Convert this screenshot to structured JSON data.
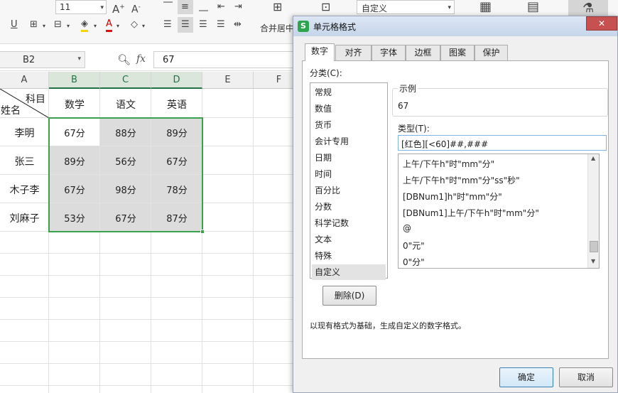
{
  "toolbar": {
    "font_size": "11",
    "number_format": "自定义",
    "merge_label": "合并居中",
    "icons": [
      "increase-font-icon",
      "decrease-font-icon",
      "align-top-icon",
      "align-middle-icon",
      "align-bottom-icon",
      "indent-icon",
      "outdent-icon",
      "underline-icon",
      "border-icon",
      "fill-color-icon",
      "font-color-icon",
      "clear-icon",
      "align-left-icon",
      "align-center-icon",
      "align-right-icon",
      "justify-icon",
      "distribute-icon"
    ]
  },
  "formula_bar": {
    "name_box": "B2",
    "fx_label": "fx",
    "value": "67"
  },
  "sheet": {
    "columns": [
      "A",
      "B",
      "C",
      "D",
      "E",
      "F"
    ],
    "header_row": {
      "corner_top": "科目",
      "corner_bottom": "姓名",
      "subjects": [
        "数学",
        "语文",
        "英语"
      ]
    },
    "rows": [
      {
        "name": "李明",
        "scores": [
          "67分",
          "88分",
          "89分"
        ]
      },
      {
        "name": "张三",
        "scores": [
          "89分",
          "56分",
          "67分"
        ]
      },
      {
        "name": "木子李",
        "scores": [
          "67分",
          "98分",
          "78分"
        ]
      },
      {
        "name": "刘麻子",
        "scores": [
          "53分",
          "67分",
          "87分"
        ]
      }
    ],
    "colors": {
      "selection_border": "#3aa24b",
      "selection_fill": "#dcdcdc",
      "header_highlight": "#217346"
    }
  },
  "dialog": {
    "title": "单元格格式",
    "close_glyph": "✕",
    "tabs": [
      "数字",
      "对齐",
      "字体",
      "边框",
      "图案",
      "保护"
    ],
    "active_tab": "数字",
    "category_label": "分类(C):",
    "categories": [
      "常规",
      "数值",
      "货币",
      "会计专用",
      "日期",
      "时间",
      "百分比",
      "分数",
      "科学记数",
      "文本",
      "特殊",
      "自定义"
    ],
    "selected_category": "自定义",
    "sample_label": "示例",
    "sample_value": "67",
    "type_label": "类型(T):",
    "type_value": "[红色][<60]##,###",
    "type_list": [
      "上午/下午h\"时\"mm\"分\"",
      "上午/下午h\"时\"mm\"分\"ss\"秒\"",
      "[DBNum1]h\"时\"mm\"分\"",
      "[DBNum1]上午/下午h\"时\"mm\"分\"",
      "@",
      "0\"元\"",
      "0\"分\""
    ],
    "delete_button": "删除(D)",
    "description": "以现有格式为基础，生成自定义的数字格式。",
    "ok_button": "确定",
    "cancel_button": "取消"
  }
}
